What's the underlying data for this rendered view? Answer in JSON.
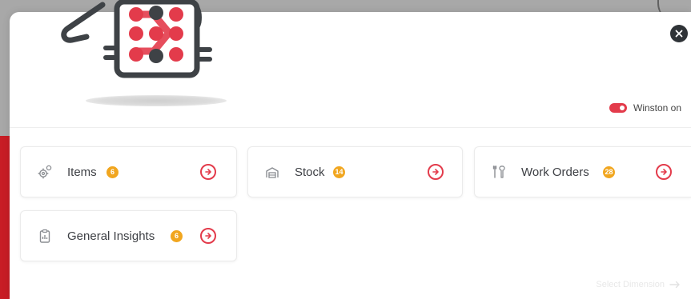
{
  "modal": {
    "toggle_label": "Winston on",
    "footer_link_label": "Select Dimension"
  },
  "cards": [
    {
      "title": "Items",
      "badge": "6",
      "icon": "gears-icon"
    },
    {
      "title": "Stock",
      "badge": "14",
      "icon": "warehouse-icon"
    },
    {
      "title": "Work Orders",
      "badge": "28",
      "icon": "tools-icon"
    },
    {
      "title": "General Insights",
      "badge": "6",
      "icon": "clipboard-icon"
    }
  ],
  "colors": {
    "accent": "#e33b4b",
    "badge": "#f1a61f",
    "close": "#2f3337",
    "background_red": "#c81d25",
    "text": "#3e4045"
  }
}
